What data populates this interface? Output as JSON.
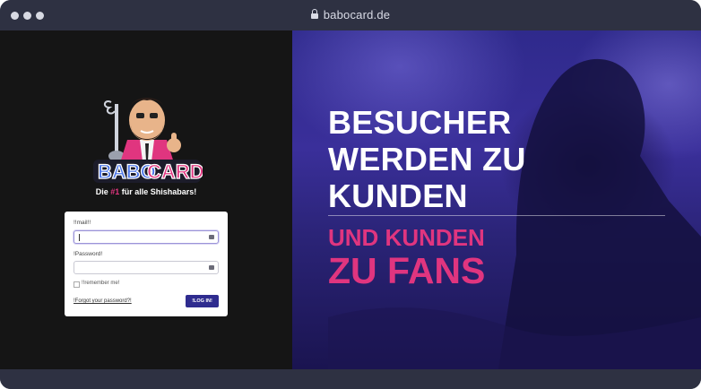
{
  "browser": {
    "url": "babocard.de"
  },
  "logo": {
    "wordmark": "BABOCARD"
  },
  "tagline": {
    "prefix": "Die ",
    "highlight": "#1",
    "suffix": " für alle Shishabars!"
  },
  "login": {
    "email_label": "!!mail!!",
    "email_value": "",
    "password_label": "!Password!",
    "password_value": "",
    "remember_label": "!!remember me!",
    "forgot_link": "!Forgot your password?!",
    "submit_label": "!LOG IN!"
  },
  "hero": {
    "line1": "BESUCHER",
    "line2": "WERDEN ZU",
    "line3": "KUNDEN",
    "sub1": "UND KUNDEN",
    "sub2": "ZU FANS"
  },
  "colors": {
    "accent_pink": "#e0357f",
    "button_blue": "#2f2c8f",
    "hero_purple": "#3a2f9a",
    "left_bg": "#151515"
  },
  "icons": [
    "lock-icon",
    "field-key-icon",
    "mascot-logo"
  ]
}
